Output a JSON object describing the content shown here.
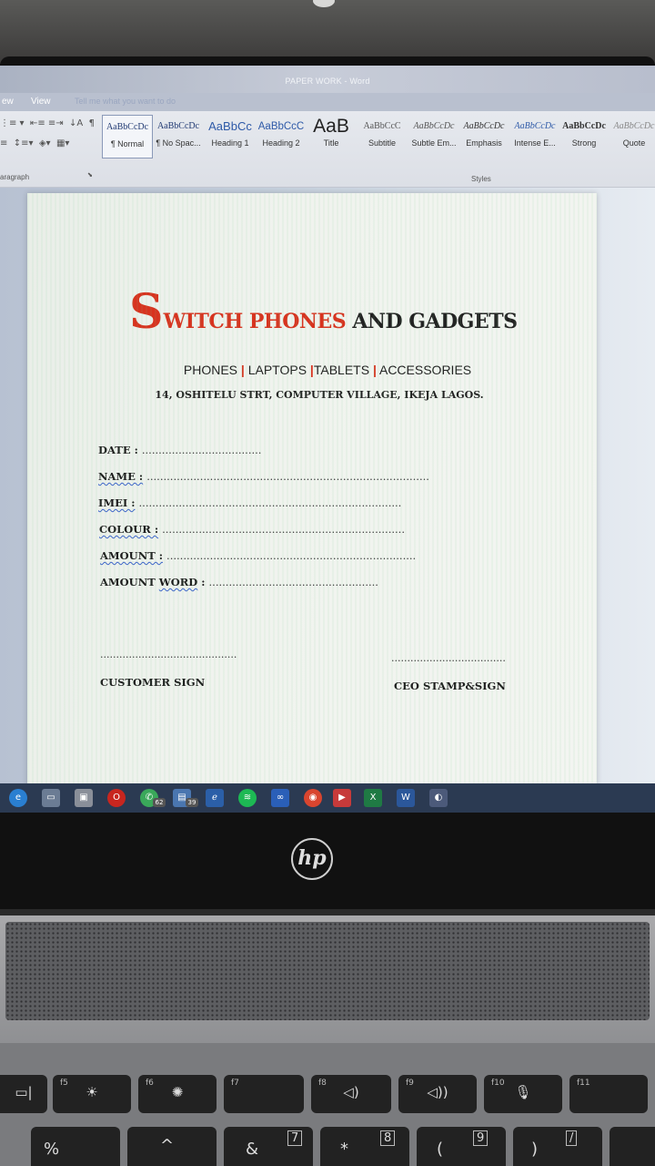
{
  "window": {
    "title": "PAPER WORK - Word"
  },
  "menu": {
    "view_partial": "ew",
    "view": "View",
    "tell_me": "Tell me what you want to do"
  },
  "ribbon": {
    "paragraph_label": "aragraph",
    "styles_label": "Styles",
    "styles": [
      {
        "sample": "AaBbCcDc",
        "name": "¶ Normal"
      },
      {
        "sample": "AaBbCcDc",
        "name": "¶ No Spac..."
      },
      {
        "sample": "AaBbCc",
        "name": "Heading 1"
      },
      {
        "sample": "AaBbCcC",
        "name": "Heading 2"
      },
      {
        "sample": "AaB",
        "name": "Title"
      },
      {
        "sample": "AaBbCcC",
        "name": "Subtitle"
      },
      {
        "sample": "AaBbCcDc",
        "name": "Subtle Em..."
      },
      {
        "sample": "AaBbCcDc",
        "name": "Emphasis"
      },
      {
        "sample": "AaBbCcDc",
        "name": "Intense E..."
      },
      {
        "sample": "AaBbCcDc",
        "name": "Strong"
      },
      {
        "sample": "AaBbCcDc",
        "name": "Quote"
      }
    ]
  },
  "document": {
    "logo": {
      "initial": "S",
      "red_rest": "WITCH PHONES",
      "black_rest": " AND GADGETS"
    },
    "categories": [
      "PHONES",
      "LAPTOPS",
      "TABLETS",
      "ACCESSORIES"
    ],
    "category_separator": "|",
    "address": "14, OSHITELU STRT, COMPUTER VILLAGE, IKEJA LAGOS.",
    "fields": {
      "date": "DATE :",
      "date_dots": "....................................",
      "name": "NAME :",
      "name_dots": ".....................................................................................",
      "imei": "IMEI :",
      "imei_dots": "...............................................................................",
      "colour": "COLOUR :",
      "colour_dots": ".........................................................................",
      "amount": "AMOUNT :",
      "amount_dots": "...........................................................................",
      "amount_word_1": "AMOUNT",
      "amount_word_2": "WORD",
      "amount_word_colon": " :",
      "amount_word_dots": "..................................................."
    },
    "signatures": {
      "customer_line": "...........................................",
      "customer_label": "CUSTOMER SIGN",
      "ceo_line": "....................................",
      "ceo_label": "CEO STAMP&SIGN"
    }
  },
  "taskbar": {
    "whatsapp_badge": "62",
    "folder_badge": "39"
  },
  "device": {
    "brand": "hp"
  },
  "keyboard": {
    "fn_keys": [
      "f5",
      "f6",
      "f7",
      "f8",
      "f9",
      "f10",
      "f11"
    ],
    "num_row": [
      "%",
      "^",
      "&",
      "7",
      "*",
      "8",
      "(",
      "9",
      ")",
      "/"
    ]
  }
}
